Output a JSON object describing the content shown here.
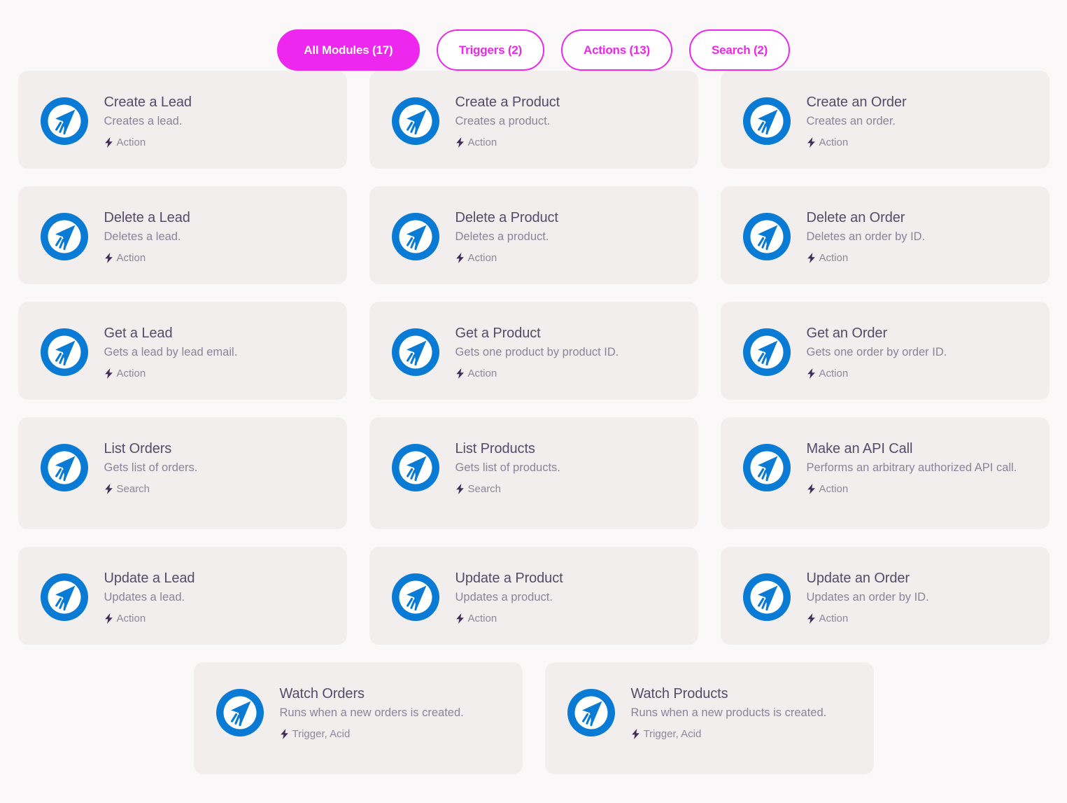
{
  "tabs": [
    {
      "label": "All Modules (17)",
      "state": "active",
      "name": "tab-all-modules"
    },
    {
      "label": "Triggers (2)",
      "state": "inactive",
      "name": "tab-triggers"
    },
    {
      "label": "Actions (13)",
      "state": "inactive",
      "name": "tab-actions"
    },
    {
      "label": "Search (2)",
      "state": "inactive",
      "name": "tab-search"
    }
  ],
  "colors": {
    "accent": "#ee27ee",
    "card_bg": "#f2eeed",
    "page_bg": "#faf8f8",
    "icon_blue": "#0a7bd4",
    "title": "#564a68",
    "description": "#8a8399",
    "meta": "#8d8799",
    "bolt": "#3f2d56"
  },
  "icon": {
    "name": "pointer-plane-icon",
    "semantic": "blue-circle-cursor-arrow"
  },
  "modules": [
    {
      "title": "Create a Lead",
      "desc": "Creates a lead.",
      "meta": "Action",
      "tall": false
    },
    {
      "title": "Create a Product",
      "desc": "Creates a product.",
      "meta": "Action",
      "tall": false
    },
    {
      "title": "Create an Order",
      "desc": "Creates an order.",
      "meta": "Action",
      "tall": false
    },
    {
      "title": "Delete a Lead",
      "desc": "Deletes a lead.",
      "meta": "Action",
      "tall": false
    },
    {
      "title": "Delete a Product",
      "desc": "Deletes a product.",
      "meta": "Action",
      "tall": false
    },
    {
      "title": "Delete an Order",
      "desc": "Deletes an order by ID.",
      "meta": "Action",
      "tall": false
    },
    {
      "title": "Get a Lead",
      "desc": "Gets a lead by lead email.",
      "meta": "Action",
      "tall": false
    },
    {
      "title": "Get a Product",
      "desc": "Gets one product by product ID.",
      "meta": "Action",
      "tall": false
    },
    {
      "title": "Get an Order",
      "desc": "Gets one order by order ID.",
      "meta": "Action",
      "tall": false
    },
    {
      "title": "List Orders",
      "desc": "Gets list of orders.",
      "meta": "Search",
      "tall": true
    },
    {
      "title": "List Products",
      "desc": "Gets list of products.",
      "meta": "Search",
      "tall": true
    },
    {
      "title": "Make an API Call",
      "desc": "Performs an arbitrary authorized API call.",
      "meta": "Action",
      "tall": true
    },
    {
      "title": "Update a Lead",
      "desc": "Updates a lead.",
      "meta": "Action",
      "tall": false
    },
    {
      "title": "Update a Product",
      "desc": "Updates a product.",
      "meta": "Action",
      "tall": false
    },
    {
      "title": "Update an Order",
      "desc": "Updates an order by ID.",
      "meta": "Action",
      "tall": false
    }
  ],
  "bottom_modules": [
    {
      "title": "Watch Orders",
      "desc": "Runs when a new orders is created.",
      "meta": "Trigger, Acid"
    },
    {
      "title": "Watch Products",
      "desc": "Runs when a new products is created.",
      "meta": "Trigger, Acid"
    }
  ]
}
